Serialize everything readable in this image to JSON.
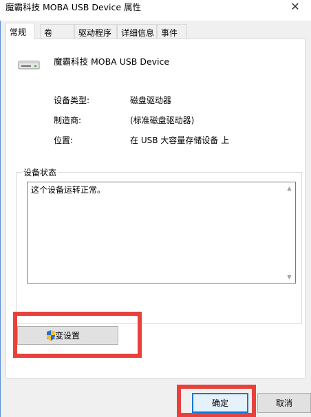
{
  "window": {
    "title": "魔霸科技 MOBA USB Device 属性",
    "close_glyph": "✕"
  },
  "tabs": [
    {
      "label": "常规",
      "active": true
    },
    {
      "label": "卷",
      "active": false
    },
    {
      "label": "驱动程序",
      "active": false
    },
    {
      "label": "详细信息",
      "active": false
    },
    {
      "label": "事件",
      "active": false
    }
  ],
  "device": {
    "name": "魔霸科技 MOBA USB Device",
    "icon": "usb-drive-icon"
  },
  "properties": [
    {
      "label": "设备类型:",
      "value": "磁盘驱动器"
    },
    {
      "label": "制造商:",
      "value": "(标准磁盘驱动器)"
    },
    {
      "label": "位置:",
      "value": "在 USB 大容量存储设备 上"
    }
  ],
  "status": {
    "group_label": "设备状态",
    "text": "这个设备运转正常。"
  },
  "buttons": {
    "change_settings": "改变设置",
    "ok": "确定",
    "cancel": "取消"
  },
  "colors": {
    "highlight": "#e8413c",
    "accent": "#0078d7"
  }
}
